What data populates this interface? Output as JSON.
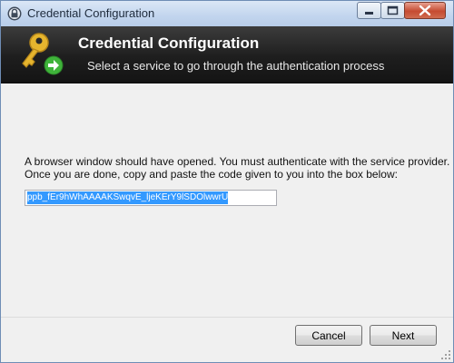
{
  "window": {
    "title": "Credential Configuration"
  },
  "banner": {
    "title": "Credential Configuration",
    "subtitle": "Select a service to go through the authentication process"
  },
  "content": {
    "instruction_line1": "A browser window should have opened. You must authenticate with the service provider.",
    "instruction_line2": "Once you are done, copy and paste the code given to you into the box below:",
    "code_value": "ppb_fEr9hWhAAAAKSwqvE_ljeKErY9lSDOlwwrU"
  },
  "buttons": {
    "cancel_label": "Cancel",
    "next_label": "Next"
  },
  "colors": {
    "banner_bg": "#1e1e1e",
    "selection": "#3399ff",
    "key_gold": "#e6b52e",
    "arrow_green": "#3fb33a"
  }
}
